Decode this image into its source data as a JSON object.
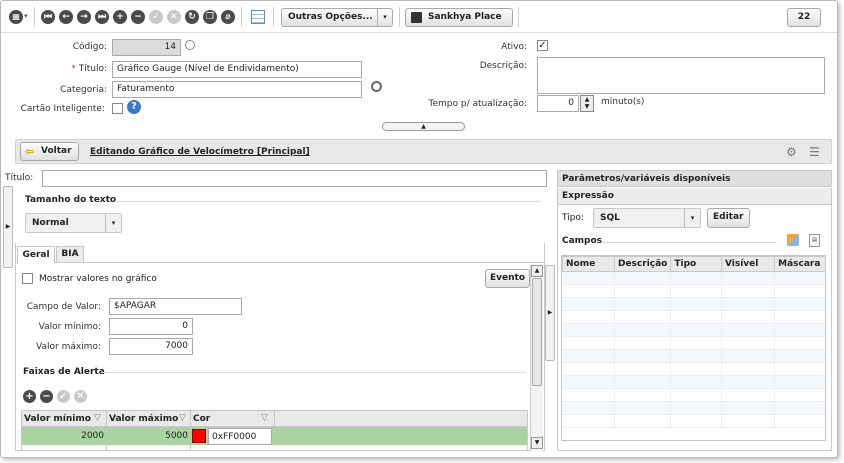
{
  "toolbar": {
    "outras_opcoes_label": "Outras Opções...",
    "sankhya_place_label": "Sankhya Place",
    "counter": "22"
  },
  "form": {
    "codigo_label": "Código:",
    "codigo_value": "14",
    "titulo_label": "Título:",
    "titulo_value": "Gráfico Gauge (Nível de Endividamento)",
    "categoria_label": "Categoria:",
    "categoria_value": "Faturamento",
    "cartao_label": "Cartão Inteligente:",
    "ativo_label": "Ativo:",
    "descricao_label": "Descrição:",
    "tempo_label": "Tempo p/ atualização:",
    "tempo_value": "0",
    "tempo_unit": "minuto(s)"
  },
  "editbar": {
    "voltar_label": "Voltar",
    "editing_text": "Editando Gráfico de Velocímetro [Principal]"
  },
  "left": {
    "titulo_label": "Título:",
    "tamanho_title": "Tamanho do texto",
    "tamanho_value": "Normal",
    "tabs": [
      "Geral",
      "BIA"
    ],
    "mostrar_label": "Mostrar valores no gráfico",
    "evento_label": "Evento",
    "campo_label": "Campo de Valor:",
    "campo_value": "$APAGAR",
    "min_label": "Valor mínimo:",
    "min_value": "0",
    "max_label": "Valor máximo:",
    "max_value": "7000",
    "faixas_title": "Faixas de Alerta",
    "grid_headers": [
      "Valor mínimo",
      "Valor máximo",
      "Cor"
    ],
    "grid_row": {
      "min": "2000",
      "max": "5000",
      "color_hex": "0xFF0000",
      "color": "#ff0000"
    }
  },
  "right": {
    "params_title": "Parâmetros/variáveis disponíveis",
    "expressao_title": "Expressão",
    "tipo_label": "Tipo:",
    "tipo_value": "SQL",
    "editar_label": "Editar",
    "campos_title": "Campos",
    "headers": [
      "Nome",
      "Descrição",
      "Tipo",
      "Visível",
      "Máscara"
    ]
  }
}
